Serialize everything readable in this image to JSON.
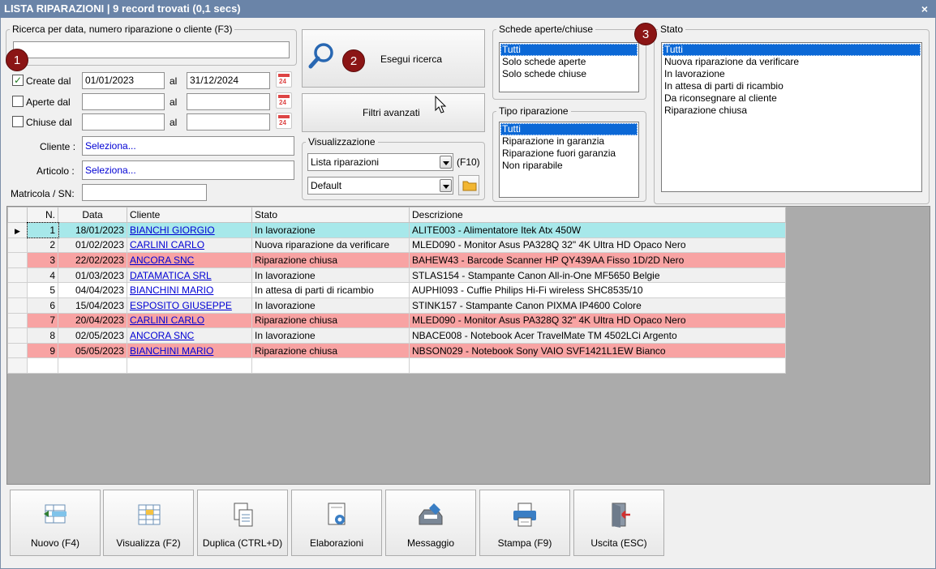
{
  "window": {
    "title": "LISTA RIPARAZIONI | 9 record trovati (0,1 secs)",
    "close": "×"
  },
  "badges": [
    "1",
    "2",
    "3"
  ],
  "search": {
    "legend": "Ricerca per data, numero riparazione o cliente (F3)",
    "value": "",
    "create": {
      "label": "Create dal",
      "checked": true,
      "from": "01/01/2023",
      "al": "al",
      "to": "31/12/2024"
    },
    "aperte": {
      "label": "Aperte dal",
      "checked": false,
      "from": "",
      "al": "al",
      "to": ""
    },
    "chiuse": {
      "label": "Chiuse dal",
      "checked": false,
      "from": "",
      "al": "al",
      "to": ""
    },
    "cal_icon_text": "24",
    "cliente": {
      "label": "Cliente :",
      "value": "Seleziona..."
    },
    "articolo": {
      "label": "Articolo :",
      "value": "Seleziona..."
    },
    "matricola": {
      "label": "Matricola / SN:",
      "value": ""
    }
  },
  "actions": {
    "search": "Esegui ricerca",
    "filters": "Filtri avanzati"
  },
  "visualizzazione": {
    "legend": "Visualizzazione",
    "view": "Lista riparazioni",
    "shortcut": "(F10)",
    "layout": "Default"
  },
  "schede": {
    "legend": "Schede aperte/chiuse",
    "items": [
      "Tutti",
      "Solo schede aperte",
      "Solo schede chiuse"
    ],
    "selected": 0
  },
  "tipo": {
    "legend": "Tipo riparazione",
    "items": [
      "Tutti",
      "Riparazione in garanzia",
      "Riparazione fuori garanzia",
      "Non riparabile"
    ],
    "selected": 0
  },
  "stato": {
    "legend": "Stato",
    "items": [
      "Tutti",
      "Nuova riparazione da verificare",
      "In lavorazione",
      "In attesa di parti di ricambio",
      "Da riconsegnare al cliente",
      "Riparazione chiusa"
    ],
    "selected": 0
  },
  "grid": {
    "columns": [
      "N.",
      "Data",
      "Cliente",
      "Stato",
      "Descrizione"
    ],
    "row_colors": {
      "current": "#a7e8ea",
      "closed": "#f8a3a3",
      "alt": "#f0f0f0",
      "normal": "#ffffff"
    },
    "rows": [
      {
        "n": "1",
        "data": "18/01/2023",
        "cliente": "BIANCHI GIORGIO",
        "stato": "In lavorazione",
        "descrizione": "ALITE003 - Alimentatore Itek Atx 450W",
        "style": "current"
      },
      {
        "n": "2",
        "data": "01/02/2023",
        "cliente": "CARLINI CARLO",
        "stato": "Nuova riparazione da verificare",
        "descrizione": "MLED090 - Monitor Asus PA328Q 32\" 4K Ultra HD Opaco Nero",
        "style": "alt"
      },
      {
        "n": "3",
        "data": "22/02/2023",
        "cliente": "ANCORA SNC",
        "stato": "Riparazione chiusa",
        "descrizione": "BAHEW43 - Barcode Scanner HP QY439AA Fisso 1D/2D Nero",
        "style": "closed"
      },
      {
        "n": "4",
        "data": "01/03/2023",
        "cliente": "DATAMATICA SRL",
        "stato": "In lavorazione",
        "descrizione": "STLAS154 - Stampante Canon All-in-One MF5650 Belgie",
        "style": "alt"
      },
      {
        "n": "5",
        "data": "04/04/2023",
        "cliente": "BIANCHINI MARIO",
        "stato": "In attesa di parti di ricambio",
        "descrizione": "AUPHI093 - Cuffie Philips Hi-Fi wireless SHC8535/10",
        "style": "normal"
      },
      {
        "n": "6",
        "data": "15/04/2023",
        "cliente": "ESPOSITO GIUSEPPE",
        "stato": "In lavorazione",
        "descrizione": "STINK157 - Stampante Canon PIXMA IP4600 Colore",
        "style": "alt"
      },
      {
        "n": "7",
        "data": "20/04/2023",
        "cliente": "CARLINI CARLO",
        "stato": "Riparazione chiusa",
        "descrizione": "MLED090 - Monitor Asus PA328Q 32\" 4K Ultra HD Opaco Nero",
        "style": "closed"
      },
      {
        "n": "8",
        "data": "02/05/2023",
        "cliente": "ANCORA SNC",
        "stato": "In lavorazione",
        "descrizione": "NBACE008 - Notebook Acer TravelMate TM 4502LCi Argento",
        "style": "alt"
      },
      {
        "n": "9",
        "data": "05/05/2023",
        "cliente": "BIANCHINI MARIO",
        "stato": "Riparazione chiusa",
        "descrizione": "NBSON029 - Notebook Sony VAIO SVF1421L1EW Bianco",
        "style": "closed"
      }
    ]
  },
  "toolbar": [
    {
      "label": "Nuovo (F4)",
      "icon": "new-record-icon"
    },
    {
      "label": "Visualizza (F2)",
      "icon": "view-grid-icon"
    },
    {
      "label": "Duplica (CTRL+D)",
      "icon": "duplicate-icon"
    },
    {
      "label": "Elaborazioni",
      "icon": "gear-document-icon"
    },
    {
      "label": "Messaggio",
      "icon": "message-icon"
    },
    {
      "label": "Stampa (F9)",
      "icon": "printer-icon"
    },
    {
      "label": "Uscita (ESC)",
      "icon": "exit-door-icon"
    }
  ]
}
